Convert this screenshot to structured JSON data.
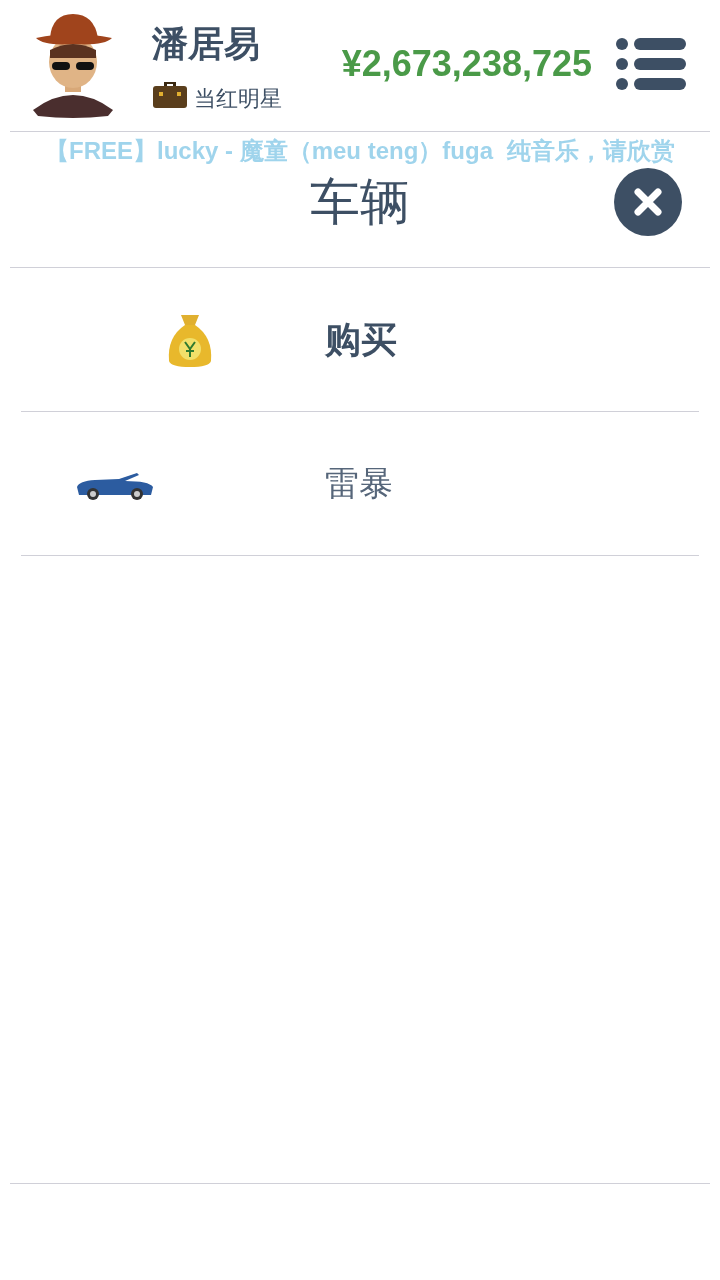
{
  "player": {
    "name": "潘居易",
    "title": "当红明星",
    "money": "¥2,673,238,725"
  },
  "now_playing": {
    "line_1": "【FREE】lucky - 魔童（meu teng）fuga",
    "line_2": "纯音乐，请欣赏"
  },
  "dialog": {
    "title": "车辆"
  },
  "items": [
    {
      "kind": "action",
      "label": "购买"
    },
    {
      "kind": "vehicle",
      "label": "雷暴"
    }
  ]
}
